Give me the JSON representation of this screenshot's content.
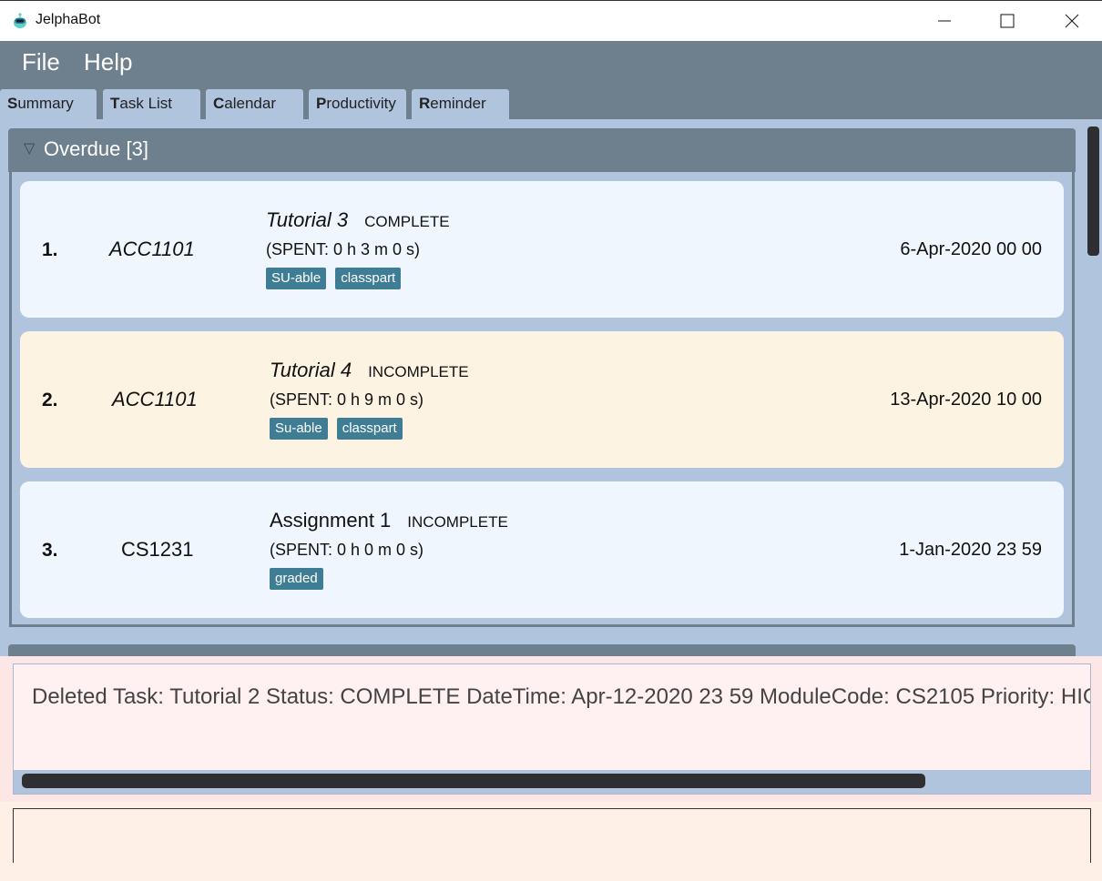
{
  "window": {
    "title": "JelphaBot",
    "controls": [
      "minimize",
      "maximize",
      "close"
    ]
  },
  "menu": {
    "items": [
      {
        "label": "File"
      },
      {
        "label": "Help"
      }
    ]
  },
  "tabs": [
    {
      "mnemonic": "S",
      "rest": "ummary",
      "label": "Summary",
      "selected": true
    },
    {
      "mnemonic": "T",
      "rest": "ask List",
      "label": "Task List"
    },
    {
      "mnemonic": "C",
      "rest": "alendar",
      "label": "Calendar"
    },
    {
      "mnemonic": "P",
      "rest": "roductivity",
      "label": "Productivity"
    },
    {
      "mnemonic": "R",
      "rest": "eminder",
      "label": "Reminder"
    }
  ],
  "summary": {
    "section": {
      "title": "Overdue [3]",
      "expanded": true,
      "arrow_icon": "triangle-down"
    },
    "tasks": [
      {
        "index": "1.",
        "module": "ACC1101",
        "name": "Tutorial 3",
        "status": "COMPLETE",
        "spent": "(SPENT: 0 h 3 m 0 s)",
        "tags": [
          "SU-able",
          "classpart"
        ],
        "datetime": "6-Apr-2020 00 00"
      },
      {
        "index": "2.",
        "module": "ACC1101",
        "name": "Tutorial 4",
        "status": "INCOMPLETE",
        "spent": "(SPENT: 0 h 9 m 0 s)",
        "tags": [
          "Su-able",
          "classpart"
        ],
        "datetime": "13-Apr-2020 10 00"
      },
      {
        "index": "3.",
        "module": "CS1231",
        "name": "Assignment 1",
        "status": "INCOMPLETE",
        "spent": "(SPENT: 0 h 0 m 0 s)",
        "tags": [
          "graded"
        ],
        "datetime": "1-Jan-2020 23 59"
      }
    ]
  },
  "result_display": {
    "text": "Deleted Task: Tutorial 2 Status: COMPLETE DateTime: Apr-12-2020 23 59 ModuleCode: CS2105 Priority: HIGH"
  },
  "command_box": {
    "value": "",
    "placeholder": ""
  },
  "colors": {
    "menu_bg": "#6e7f8d",
    "tab_bg": "#b0c4de",
    "card_default": "#eff6fd",
    "card_highlight": "#fdf3e3",
    "tag_bg": "#3f7d95",
    "result_bg": "#fff0f2",
    "command_bg": "#fef0e6"
  }
}
